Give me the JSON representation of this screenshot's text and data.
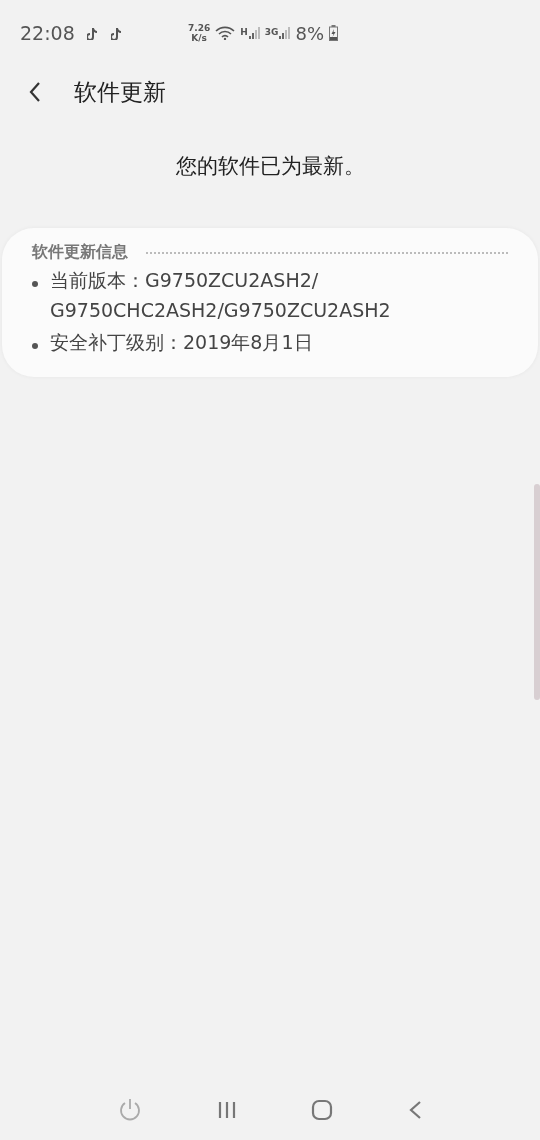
{
  "status_bar": {
    "time": "22:08",
    "net_speed": "7.26",
    "net_unit": "K/s",
    "signal_1_label": "H",
    "signal_2_label": "3G",
    "battery": "8%"
  },
  "header": {
    "title": "软件更新"
  },
  "message": "您的软件已为最新。",
  "info_card": {
    "title": "软件更新信息",
    "items": [
      {
        "label": "当前版本：",
        "value": "G9750ZCU2ASH2/ G9750CHC2ASH2/G9750ZCU2ASH2"
      },
      {
        "label": "安全补丁级别：",
        "value": "2019年8月1日"
      }
    ]
  }
}
